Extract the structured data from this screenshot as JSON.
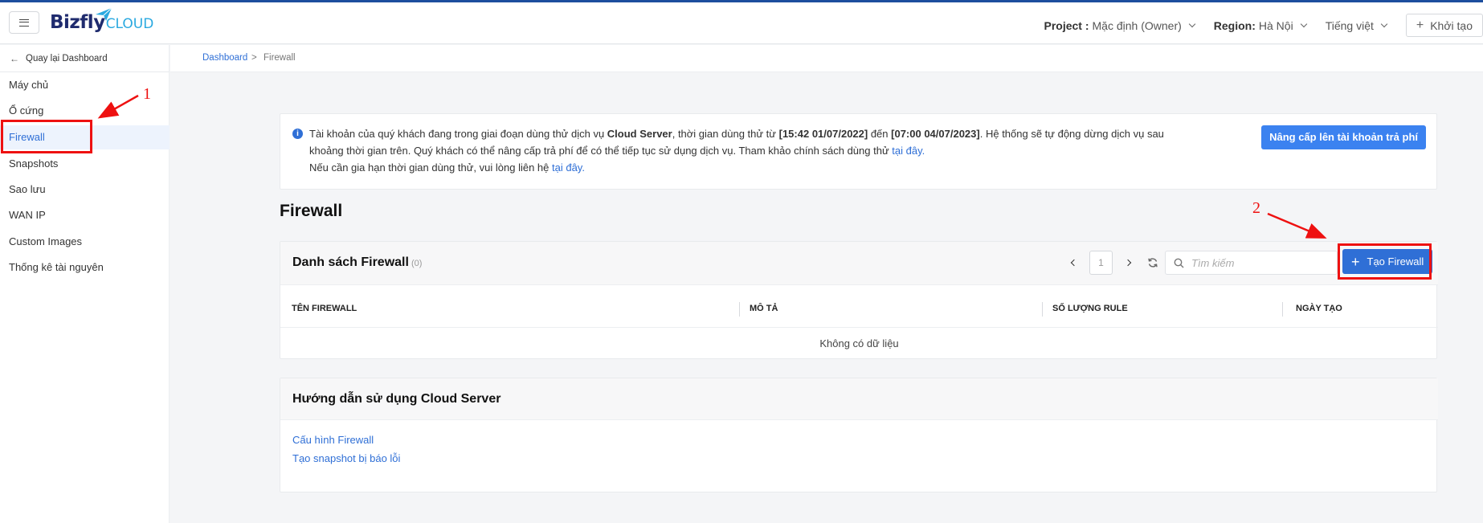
{
  "header": {
    "menu_icon": "hamburger-icon",
    "logo_main": "Bizfly",
    "logo_sub": "CLOUD",
    "project_label": "Project :",
    "project_value": "Mặc định (Owner)",
    "region_label": "Region:",
    "region_value": "Hà Nội",
    "language": "Tiếng việt",
    "create_label": "Khởi tạo"
  },
  "sidebar": {
    "back_label": "Quay lại Dashboard",
    "items": [
      {
        "label": "Máy chủ"
      },
      {
        "label": "Ổ cứng"
      },
      {
        "label": "Firewall",
        "active": true
      },
      {
        "label": "Snapshots"
      },
      {
        "label": "Sao lưu"
      },
      {
        "label": "WAN IP"
      },
      {
        "label": "Custom Images"
      },
      {
        "label": "Thống kê tài nguyên"
      }
    ]
  },
  "breadcrumb": {
    "items": [
      "Dashboard",
      "Firewall"
    ],
    "separator": ">"
  },
  "notice": {
    "line1_a": "Tài khoản của quý khách đang trong giai đoạn dùng thử dịch vụ ",
    "line1_b": "Cloud Server",
    "line1_c": ", thời gian dùng thử từ ",
    "line1_d": "[15:42 01/07/2022]",
    "line1_e": " đến ",
    "line1_f": "[07:00 04/07/2023]",
    "line1_g": ". Hệ thống sẽ tự động dừng dịch vụ sau",
    "line2_a": "khoảng thời gian trên. Quý khách có thể nâng cấp trả phí để có thể tiếp tục sử dụng dịch vụ. Tham khảo chính sách dùng thử ",
    "line2_link": "tại đây.",
    "line3_a": "Nếu cần gia hạn thời gian dùng thử, vui lòng liên hệ ",
    "line3_link": "tại đây.",
    "upgrade_button": "Nâng cấp lên tài khoản trả phí"
  },
  "page_title": "Firewall",
  "firewall_list": {
    "title": "Danh sách Firewall",
    "count": "(0)",
    "current_page": "1",
    "search_placeholder": "Tìm kiếm",
    "add_button": "Tạo Firewall",
    "columns": [
      "TÊN FIREWALL",
      "MÔ TẢ",
      "SỐ LƯỢNG RULE",
      "NGÀY TẠO"
    ],
    "empty_text": "Không có dữ liệu"
  },
  "guide": {
    "title": "Hướng dẫn sử dụng Cloud Server",
    "links": [
      "Cấu hình Firewall",
      "Tạo snapshot bị báo lỗi"
    ]
  },
  "annotations": {
    "label_1": "1",
    "label_2": "2",
    "color": "#e11111"
  },
  "colors": {
    "accent": "#2f6fd6",
    "brand_dark": "#1f2b6e",
    "brand_light": "#2aa9e0",
    "topline": "#1d4e9e"
  }
}
